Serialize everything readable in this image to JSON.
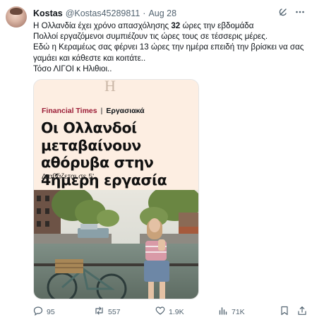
{
  "author": {
    "name": "Kostas",
    "handle": "@Kostas45289811",
    "separator": "·",
    "date": "Aug 28"
  },
  "tweet": {
    "line1_before": "Η Ολλανδία έχει χρόνο απασχόλησης ",
    "line1_bold": "32",
    "line1_after": " ώρες την εβδομάδα",
    "line2": "Πολλοί εργαζόμενοι συμπιέζουν τις ώρες τους σε τέσσερις μέρες.",
    "line3": "Εδώ η Κεραμέως σας φέρνει 13 ώρες την ημέρα επειδή την βρίσκει να σας",
    "line4": "γαμάει και κάθεστε και κοιτάτε..",
    "line5": "Τόσο ΛΙΓΟΙ κ Ηλιθιοι.."
  },
  "card": {
    "logo_glyph": "H",
    "source": "Financial Times",
    "divider": "|",
    "category": "Εργασιακά",
    "headline": "Οι Ολλανδοί μεταβαίνουν αθόρυβα στην 4ήμερη εργασία",
    "read_time": "Διαβάζεται σε 5'"
  },
  "metrics": {
    "replies": "95",
    "reposts": "557",
    "likes": "1.9K",
    "views": "71K"
  },
  "icons": {
    "grok": "grok-icon",
    "more": "more-icon",
    "reply": "reply-icon",
    "repost": "repost-icon",
    "like": "heart-icon",
    "views": "views-icon",
    "bookmark": "bookmark-icon",
    "share": "share-icon"
  },
  "colors": {
    "ft_brand": "#9b1c36",
    "card_bg": "#fdeee2",
    "muted": "#536471"
  }
}
